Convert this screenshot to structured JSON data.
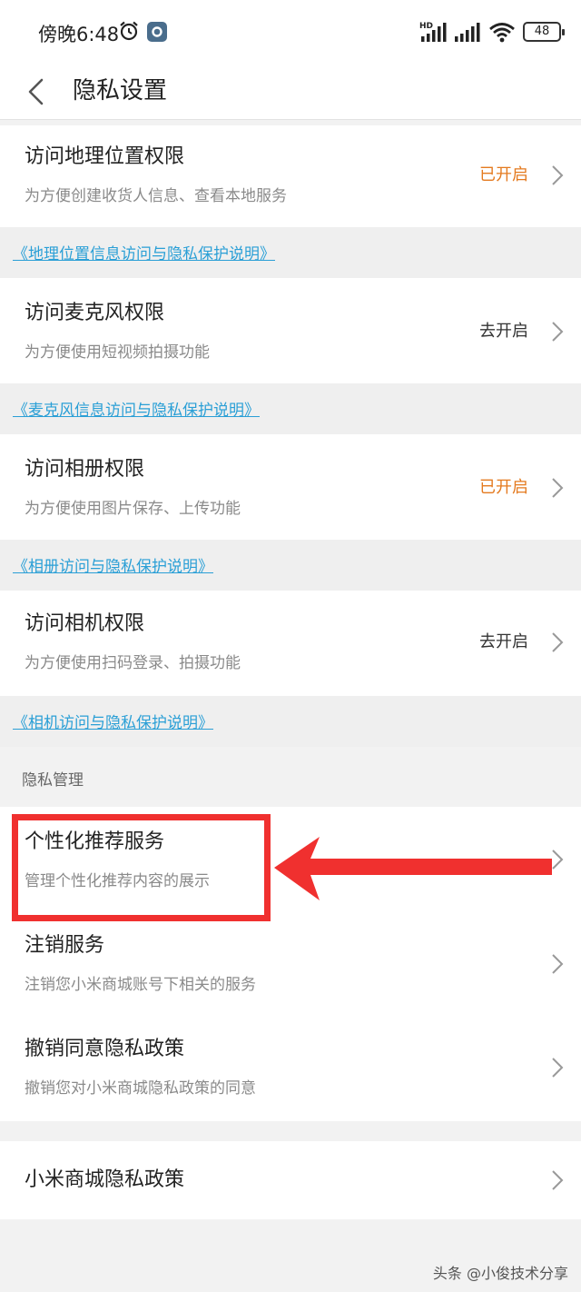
{
  "status_bar": {
    "time": "傍晚6:48",
    "battery": "48",
    "icons": [
      "alarm-icon",
      "settings-badge-icon",
      "hd-signal-icon",
      "signal-icon",
      "wifi-icon",
      "battery-icon"
    ]
  },
  "header": {
    "title": "隐私设置"
  },
  "permissions": [
    {
      "title": "访问地理位置权限",
      "subtitle": "为方便创建收货人信息、查看本地服务",
      "status": "已开启",
      "link": "《地理位置信息访问与隐私保护说明》"
    },
    {
      "title": "访问麦克风权限",
      "subtitle": "为方便使用短视频拍摄功能",
      "status": "去开启",
      "link": "《麦克风信息访问与隐私保护说明》"
    },
    {
      "title": "访问相册权限",
      "subtitle": "为方便使用图片保存、上传功能",
      "status": "已开启",
      "link": "《相册访问与隐私保护说明》"
    },
    {
      "title": "访问相机权限",
      "subtitle": "为方便使用扫码登录、拍摄功能",
      "status": "去开启",
      "link": "《相机访问与隐私保护说明》"
    }
  ],
  "privacy_section": {
    "label": "隐私管理",
    "items": [
      {
        "title": "个性化推荐服务",
        "subtitle": "管理个性化推荐内容的展示"
      },
      {
        "title": "注销服务",
        "subtitle": "注销您小米商城账号下相关的服务"
      },
      {
        "title": "撤销同意隐私政策",
        "subtitle": "撤销您对小米商城隐私政策的同意"
      }
    ]
  },
  "policy": {
    "title": "小米商城隐私政策"
  },
  "watermark": "头条 @小俊技术分享",
  "colors": {
    "status_on": "#e47a1f",
    "link": "#2a9fd6",
    "highlight": "#f0302f",
    "background": "#f2f2f2"
  }
}
